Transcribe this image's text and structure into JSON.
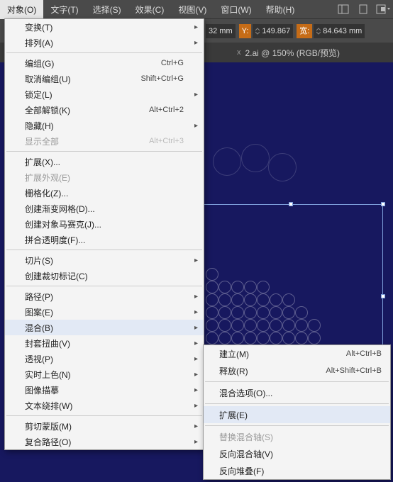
{
  "menubar": {
    "items": [
      "对象(O)",
      "文字(T)",
      "选择(S)",
      "效果(C)",
      "视图(V)",
      "窗口(W)",
      "帮助(H)"
    ]
  },
  "toolbar": {
    "x_value": "32 mm",
    "y_label": "Y:",
    "y_value": "149.867",
    "w_label": "宽:",
    "w_value": "84.643",
    "unit": "mm"
  },
  "tab": {
    "title": "2.ai @ 150% (RGB/预览)",
    "close": "x"
  },
  "menu": {
    "transform": "变换(T)",
    "arrange": "排列(A)",
    "group": "编组(G)",
    "group_sc": "Ctrl+G",
    "ungroup": "取消编组(U)",
    "ungroup_sc": "Shift+Ctrl+G",
    "lock": "锁定(L)",
    "unlockall": "全部解锁(K)",
    "unlockall_sc": "Alt+Ctrl+2",
    "hide": "隐藏(H)",
    "showall": "显示全部",
    "showall_sc": "Alt+Ctrl+3",
    "expand": "扩展(X)...",
    "expandapp": "扩展外观(E)",
    "rasterize": "栅格化(Z)...",
    "gradmesh": "创建渐变网格(D)...",
    "mosaic": "创建对象马赛克(J)...",
    "flatten": "拼合透明度(F)...",
    "slice": "切片(S)",
    "trimmarks": "创建裁切标记(C)",
    "path": "路径(P)",
    "pattern": "图案(E)",
    "blend": "混合(B)",
    "envelope": "封套扭曲(V)",
    "perspective": "透视(P)",
    "livepaint": "实时上色(N)",
    "imagetrace": "图像描摹",
    "textwrap": "文本绕排(W)",
    "clipmask": "剪切蒙版(M)",
    "compound": "复合路径(O)"
  },
  "submenu": {
    "make": "建立(M)",
    "make_sc": "Alt+Ctrl+B",
    "release": "释放(R)",
    "release_sc": "Alt+Shift+Ctrl+B",
    "options": "混合选项(O)...",
    "expand": "扩展(E)",
    "replspine": "替换混合轴(S)",
    "revspine": "反向混合轴(V)",
    "revfront": "反向堆叠(F)"
  }
}
